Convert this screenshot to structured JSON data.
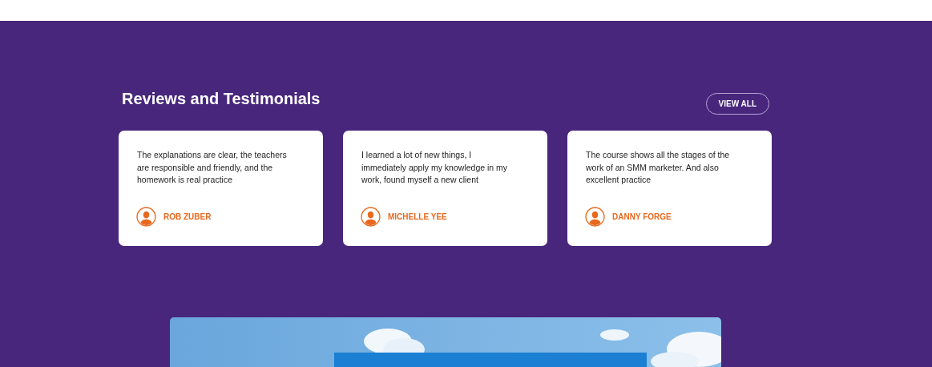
{
  "section": {
    "title": "Reviews and Testimonials",
    "view_all": "VIEW ALL"
  },
  "reviews": [
    {
      "text": "The explanations are clear, the teachers are responsible and friendly, and the homework is real practice",
      "author": "ROB ZUBER"
    },
    {
      "text": "I learned a lot of new things, I immediately apply my knowledge in my work, found myself a new client",
      "author": "MICHELLE YEE"
    },
    {
      "text": "The course shows all the stages of the work of an SMM marketer. And also excellent practice",
      "author": "DANNY FORGE"
    }
  ]
}
